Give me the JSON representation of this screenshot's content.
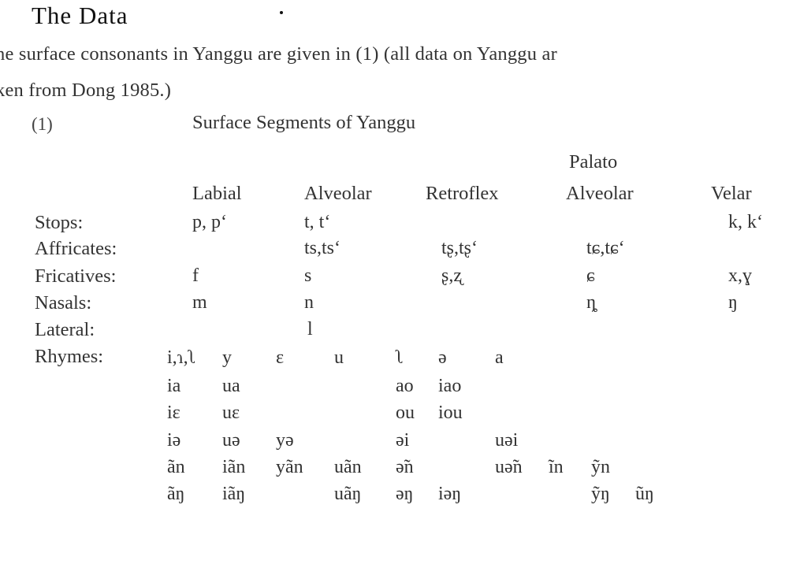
{
  "section": {
    "heading": "The Data"
  },
  "paragraph": {
    "line1": "he surface consonants in Yanggu are given in (1) (all data on Yanggu ar",
    "line2": "ken from Dong 1985.)"
  },
  "example": {
    "number": "(1)",
    "caption": "Surface Segments of Yanggu"
  },
  "consonant_table": {
    "columns": [
      {
        "top": "",
        "label": "Labial"
      },
      {
        "top": "",
        "label": "Alveolar"
      },
      {
        "top": "",
        "label": "Retroflex"
      },
      {
        "top": "Palato",
        "label": "Alveolar"
      },
      {
        "top": "",
        "label": "Velar"
      }
    ],
    "rows": [
      {
        "label": "Stops:",
        "cells": [
          "p, pʻ",
          "t, tʻ",
          "",
          "",
          "k, kʻ"
        ]
      },
      {
        "label": "Affricates:",
        "cells": [
          "",
          "ts,tsʻ",
          "tʂ,tʂʻ",
          "tɕ,tɕʻ",
          ""
        ]
      },
      {
        "label": "Fricatives:",
        "cells": [
          "f",
          "s",
          "ʂ,ʐ",
          "ɕ",
          "x,ɣ"
        ]
      },
      {
        "label": "Nasals:",
        "cells": [
          "m",
          "n",
          "",
          "ȵ",
          "ŋ"
        ]
      },
      {
        "label": "Lateral:",
        "cells": [
          "",
          "l",
          "",
          "",
          ""
        ]
      }
    ]
  },
  "rhymes": {
    "label": "Rhymes:",
    "rows": [
      [
        "i,ɿ,ʅ",
        "y",
        "ɛ",
        "u",
        "ʅ",
        "ə",
        "a",
        "",
        "",
        ""
      ],
      [
        "ia",
        "ua",
        "",
        "",
        "ao",
        "iao",
        "",
        "",
        "",
        ""
      ],
      [
        "iɛ",
        "uɛ",
        "",
        "",
        "ou",
        "iou",
        "",
        "",
        "",
        ""
      ],
      [
        "iə",
        "uə",
        "yə",
        "",
        "əi",
        "",
        "uəi",
        "",
        "",
        ""
      ],
      [
        "ãn",
        "iãn",
        "yãn",
        "uãn",
        "ə̃n",
        "",
        "uə̃n",
        "ĩn",
        "ỹn",
        ""
      ],
      [
        "ãŋ",
        "iãŋ",
        "",
        "uãŋ",
        "əŋ",
        "iəŋ",
        "",
        "",
        "ỹŋ",
        "ũŋ"
      ]
    ]
  }
}
